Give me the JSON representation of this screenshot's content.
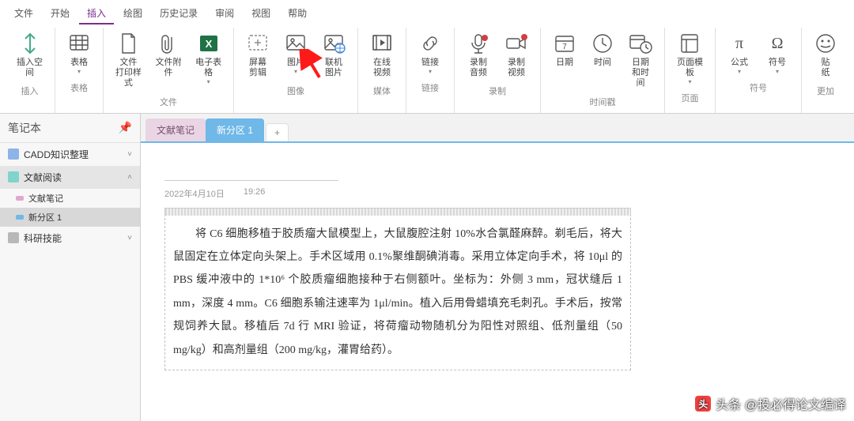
{
  "menu": [
    "文件",
    "开始",
    "插入",
    "绘图",
    "历史记录",
    "审阅",
    "视图",
    "帮助"
  ],
  "active_menu": 2,
  "ribbon": {
    "groups": [
      {
        "name": "插入",
        "buttons": [
          {
            "label": "插入空间",
            "icon": "insert-space"
          }
        ]
      },
      {
        "name": "表格",
        "buttons": [
          {
            "label": "表格",
            "icon": "table",
            "caret": true
          }
        ]
      },
      {
        "name": "文件",
        "buttons": [
          {
            "label": "文件\n打印样式",
            "icon": "file-print"
          },
          {
            "label": "文件附件",
            "icon": "attachment"
          },
          {
            "label": "电子表格",
            "icon": "spreadsheet",
            "caret": true
          }
        ]
      },
      {
        "name": "图像",
        "buttons": [
          {
            "label": "屏幕剪辑",
            "icon": "screenshot"
          },
          {
            "label": "图片",
            "icon": "picture",
            "caret": true
          },
          {
            "label": "联机图片",
            "icon": "online-picture"
          }
        ]
      },
      {
        "name": "媒体",
        "buttons": [
          {
            "label": "在线\n视频",
            "icon": "video"
          }
        ]
      },
      {
        "name": "链接",
        "buttons": [
          {
            "label": "链接",
            "icon": "link",
            "caret": true
          }
        ]
      },
      {
        "name": "录制",
        "buttons": [
          {
            "label": "录制\n音频",
            "icon": "audio-rec"
          },
          {
            "label": "录制\n视频",
            "icon": "video-rec"
          }
        ]
      },
      {
        "name": "时间戳",
        "buttons": [
          {
            "label": "日期",
            "icon": "date"
          },
          {
            "label": "时间",
            "icon": "time"
          },
          {
            "label": "日期和时间",
            "icon": "datetime"
          }
        ]
      },
      {
        "name": "页面",
        "buttons": [
          {
            "label": "页面模板",
            "icon": "template",
            "caret": true
          }
        ]
      },
      {
        "name": "符号",
        "buttons": [
          {
            "label": "公式",
            "icon": "equation",
            "caret": true
          },
          {
            "label": "符号",
            "icon": "symbol",
            "caret": true
          }
        ]
      },
      {
        "name": "更加",
        "buttons": [
          {
            "label": "贴\n纸",
            "icon": "sticker"
          }
        ]
      }
    ]
  },
  "sidebar": {
    "title": "笔记本",
    "notebooks": [
      {
        "name": "CADD知识整理",
        "color": "#8cb4e8",
        "open": false
      },
      {
        "name": "文献阅读",
        "color": "#80d4cc",
        "open": true,
        "sel": true,
        "sections": [
          {
            "name": "文献笔记",
            "color": "#e0a8d0"
          },
          {
            "name": "新分区 1",
            "color": "#6fb8e8",
            "sel": true
          }
        ]
      },
      {
        "name": "科研技能",
        "color": "#b8b8b8",
        "open": false
      }
    ]
  },
  "tabs": [
    {
      "label": "文献笔记",
      "active": false
    },
    {
      "label": "新分区 1",
      "active": true
    }
  ],
  "page": {
    "date": "2022年4月10日",
    "time": "19:26",
    "title_placeholder": "",
    "body": "将 C6 细胞移植于胶质瘤大鼠模型上，大鼠腹腔注射 10%水合氯醛麻醉。剃毛后，将大鼠固定在立体定向头架上。手术区域用 0.1%聚维酮碘消毒。采用立体定向手术，将 10μl 的 PBS 缓冲液中的 1*10⁶ 个胶质瘤细胞接种于右侧额叶。坐标为：外侧 3 mm，冠状缝后 1 mm，深度 4 mm。C6 细胞系输注速率为 1μl/min。植入后用骨蜡填充毛刺孔。手术后，按常规饲养大鼠。移植后 7d 行 MRI 验证，将荷瘤动物随机分为阳性对照组、低剂量组（50 mg/kg）和高剂量组（200 mg/kg，灌胃给药）。"
  },
  "watermark": "头条 @投必得论文编译"
}
